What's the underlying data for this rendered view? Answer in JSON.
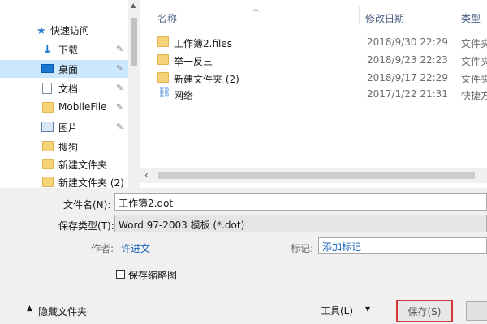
{
  "nav": {
    "items": [
      {
        "label": "快速访问",
        "icon": "star-icon"
      },
      {
        "label": "下载",
        "icon": "download-arrow-icon"
      },
      {
        "label": "桌面",
        "icon": "desktop-icon"
      },
      {
        "label": "文档",
        "icon": "document-icon"
      },
      {
        "label": "MobileFile",
        "icon": "folder-icon"
      },
      {
        "label": "图片",
        "icon": "pictures-icon"
      },
      {
        "label": "搜狗",
        "icon": "folder-icon"
      },
      {
        "label": "新建文件夹",
        "icon": "folder-icon"
      },
      {
        "label": "新建文件夹 (2)",
        "icon": "folder-icon"
      }
    ]
  },
  "list": {
    "columns": {
      "name": "名称",
      "date": "修改日期",
      "type": "类型"
    },
    "rows": [
      {
        "name": "工作簿2.files",
        "date": "2018/9/30 22:29",
        "type": "文件夹",
        "icon": "folder-icon"
      },
      {
        "name": "举一反三",
        "date": "2018/9/23 22:23",
        "type": "文件夹",
        "icon": "folder-icon"
      },
      {
        "name": "新建文件夹 (2)",
        "date": "2018/9/17 22:29",
        "type": "文件夹",
        "icon": "folder-icon"
      },
      {
        "name": "网络",
        "date": "2017/1/22 21:31",
        "type": "快捷方",
        "icon": "network-shortcut-icon"
      }
    ]
  },
  "form": {
    "filename_label": "文件名(N):",
    "filename_value": "工作簿2.dot",
    "filetype_label": "保存类型(T):",
    "filetype_value": "Word 97-2003 模板 (*.dot)",
    "author_label": "作者:",
    "author_value": "许进文",
    "tags_label": "标记:",
    "tags_value": "添加标记",
    "thumbnail_label": "保存缩略图"
  },
  "footer": {
    "hide_folders_label": "隐藏文件夹",
    "tools_label": "工具(L)",
    "save_label": "保存(S)"
  },
  "colors": {
    "accent": "#0078d7",
    "highlight": "#d23a3a",
    "selected": "#cce8ff"
  }
}
